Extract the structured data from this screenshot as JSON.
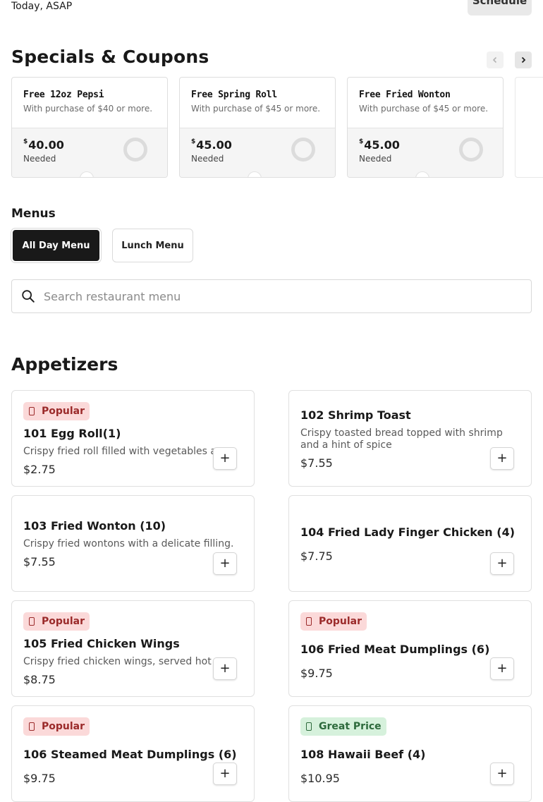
{
  "order": {
    "when": "Today, ASAP",
    "schedule_label": "Schedule"
  },
  "specials": {
    "heading": "Specials & Coupons",
    "prev_icon": "chevron-left-icon",
    "next_icon": "chevron-right-icon",
    "coupons": [
      {
        "title": "Free 12oz Pepsi",
        "desc": "With purchase of $40 or more.",
        "currency": "$",
        "amount": "40.00",
        "needed": "Needed"
      },
      {
        "title": "Free Spring Roll",
        "desc": "With purchase of $45 or more.",
        "currency": "$",
        "amount": "45.00",
        "needed": "Needed"
      },
      {
        "title": "Free Fried Wonton",
        "desc": "With purchase of $45 or more.",
        "currency": "$",
        "amount": "45.00",
        "needed": "Needed"
      }
    ]
  },
  "menus": {
    "heading": "Menus",
    "tabs": [
      {
        "label": "All Day Menu",
        "selected": true
      },
      {
        "label": "Lunch Menu",
        "selected": false
      }
    ]
  },
  "search": {
    "placeholder": "Search restaurant menu"
  },
  "appetizers": {
    "heading": "Appetizers",
    "items": [
      {
        "badge": "Popular",
        "name": "101 Egg Roll(1)",
        "desc": "Crispy fried roll filled with vegetables and meat.",
        "price": "$2.75"
      },
      {
        "badge": "",
        "name": "102 Shrimp Toast",
        "desc": "Crispy toasted bread topped with shrimp and a hint of spice",
        "price": "$7.55"
      },
      {
        "badge": "",
        "name": "103 Fried Wonton (10)",
        "desc": "Crispy fried wontons with a delicate filling.",
        "price": "$7.55"
      },
      {
        "badge": "",
        "name": "104 Fried Lady Finger Chicken (4)",
        "desc": "",
        "price": "$7.75"
      },
      {
        "badge": "Popular",
        "name": "105 Fried Chicken Wings",
        "desc": "Crispy fried chicken wings, served hot",
        "price": "$8.75"
      },
      {
        "badge": "Popular",
        "name": "106 Fried Meat Dumplings (6)",
        "desc": "",
        "price": "$9.75"
      },
      {
        "badge": "Popular",
        "name": "106 Steamed Meat Dumplings (6)",
        "desc": "",
        "price": "$9.75"
      },
      {
        "badge": "Great Price",
        "name": "108 Hawaii Beef (4)",
        "desc": "",
        "price": "$10.95"
      }
    ],
    "add_label": "+"
  },
  "colors": {
    "popular_bg": "#fbd9d9",
    "popular_fg": "#9b2a2a",
    "great_bg": "#d6f1dc",
    "great_fg": "#2d6a3c",
    "selected_tab": "#191919"
  }
}
